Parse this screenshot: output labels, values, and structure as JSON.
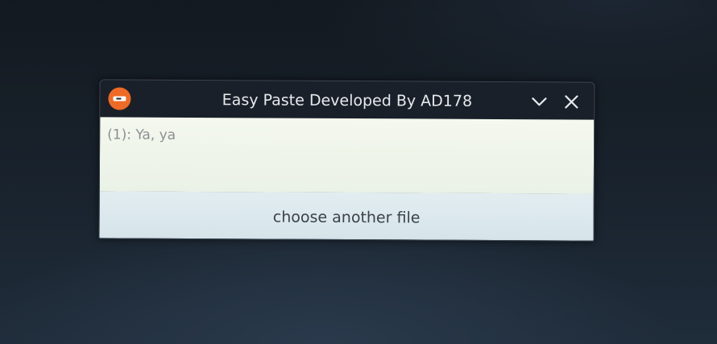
{
  "window": {
    "title": "Easy Paste Developed By AD178",
    "app_icon": "usb-drive-icon",
    "controls": {
      "minimize_icon": "chevron-down-icon",
      "close_icon": "close-icon"
    }
  },
  "content": {
    "text": "(1): Ya, ya"
  },
  "actions": {
    "choose_label": "choose another file"
  },
  "colors": {
    "app_icon_accent": "#ef6a25",
    "titlebar": "#1a2029",
    "content_background": "#f4f8ee",
    "button_background": "#e2edf0"
  }
}
